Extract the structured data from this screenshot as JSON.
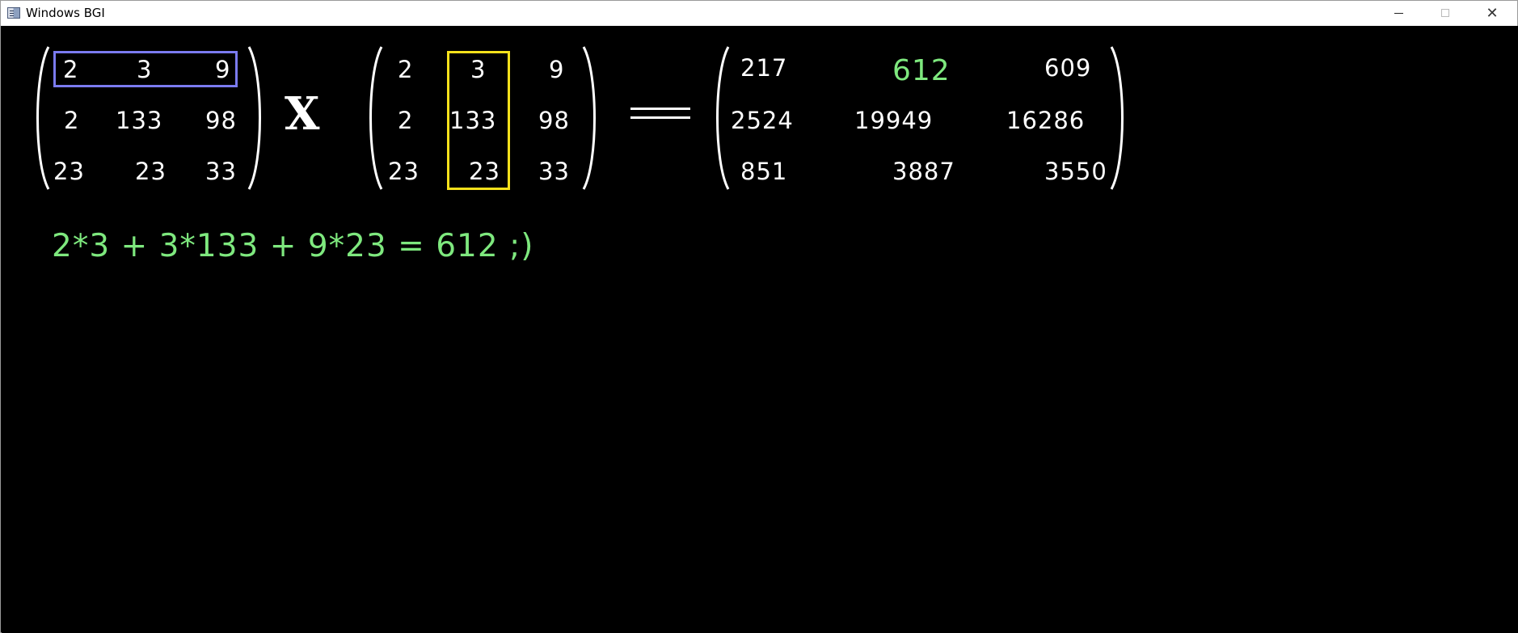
{
  "window": {
    "title": "Windows BGI",
    "buttons": {
      "minimize": "—",
      "maximize": "☐",
      "close": "✕"
    }
  },
  "matrices": {
    "a": [
      [
        "2",
        "3",
        "9"
      ],
      [
        "2",
        "133",
        "98"
      ],
      [
        "23",
        "23",
        "33"
      ]
    ],
    "b": [
      [
        "2",
        "3",
        "9"
      ],
      [
        "2",
        "133",
        "98"
      ],
      [
        "23",
        "23",
        "33"
      ]
    ],
    "result": [
      [
        "217",
        "612",
        "609"
      ],
      [
        "2524",
        "19949",
        "16286"
      ],
      [
        "851",
        "3887",
        "3550"
      ]
    ]
  },
  "operators": {
    "multiply": "X"
  },
  "formula": "2*3 + 3*133 + 9*23 = 612 ;)",
  "colors": {
    "row_highlight": "#7b7bf0",
    "column_highlight": "#f6e11b",
    "result_highlight": "#7ee87e",
    "background": "#000000",
    "foreground": "#ffffff"
  }
}
